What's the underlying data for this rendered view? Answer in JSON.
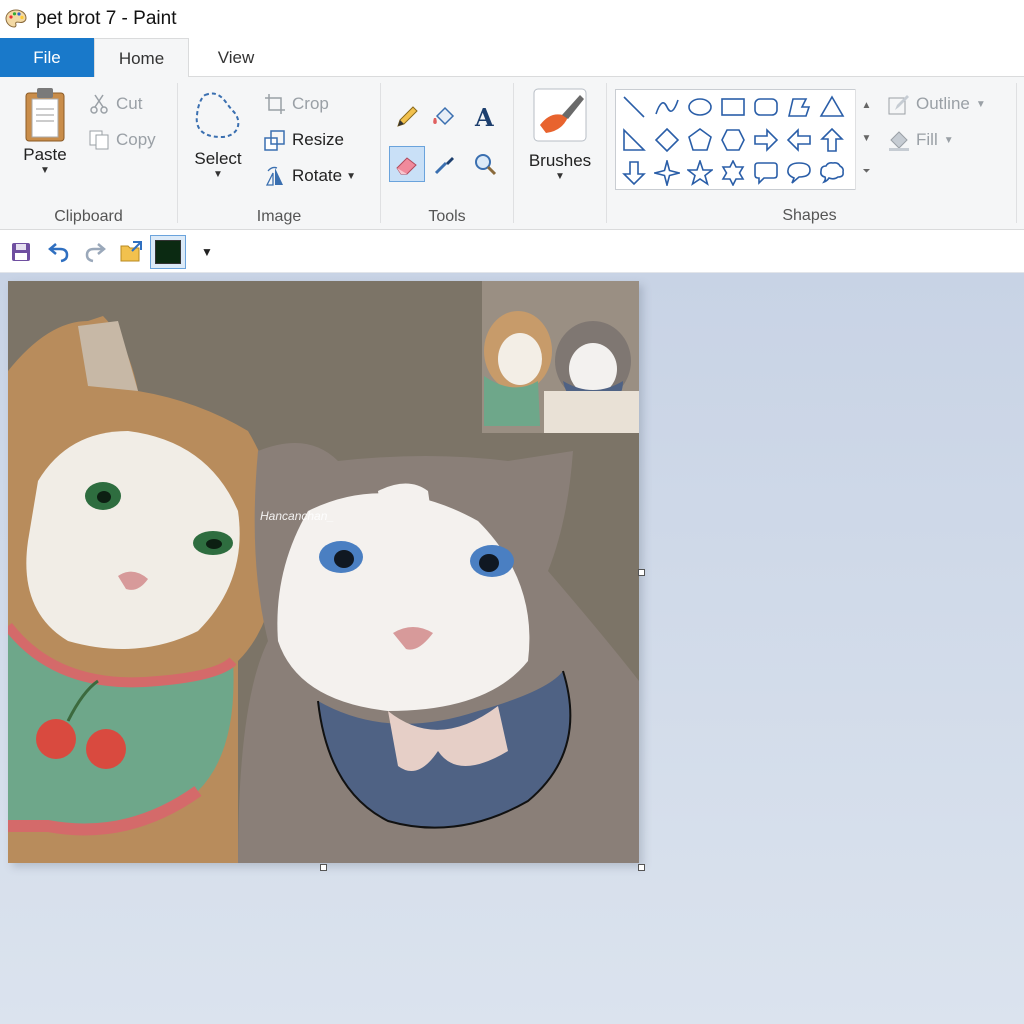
{
  "window": {
    "title": "pet brot 7 - Paint",
    "app_icon": "paint-palette-icon"
  },
  "tabs": [
    {
      "label": "File",
      "active": false
    },
    {
      "label": "Home",
      "active": true
    },
    {
      "label": "View",
      "active": false
    }
  ],
  "clipboard": {
    "group_label": "Clipboard",
    "paste": "Paste",
    "cut": "Cut",
    "copy": "Copy"
  },
  "image": {
    "group_label": "Image",
    "select": "Select",
    "crop": "Crop",
    "resize": "Resize",
    "rotate": "Rotate"
  },
  "tools": {
    "group_label": "Tools",
    "selected_tool": "eraser"
  },
  "brushes": {
    "label": "Brushes"
  },
  "shapes": {
    "group_label": "Shapes",
    "outline": "Outline",
    "fill": "Fill",
    "items": [
      "line",
      "curve",
      "oval",
      "rectangle",
      "rounded-rectangle",
      "polygon",
      "triangle",
      "right-triangle",
      "diamond",
      "pentagon",
      "hexagon",
      "right-arrow",
      "left-arrow",
      "up-arrow",
      "down-arrow",
      "four-point-star",
      "five-point-star",
      "six-point-star",
      "rounded-rectangular-callout",
      "oval-callout",
      "cloud-callout"
    ]
  },
  "quick_access": {
    "current_color": "#0b2a12"
  },
  "canvas": {
    "signature": "Hancanchan_"
  },
  "colors": {
    "accent": "#1979ca",
    "ribbon_bg": "#f5f6f7",
    "workspace_bg": "#cdd8e8"
  }
}
